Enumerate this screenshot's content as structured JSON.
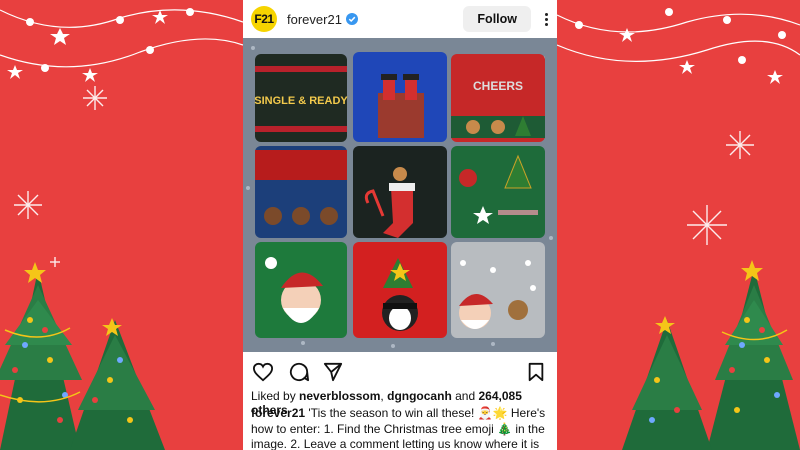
{
  "post": {
    "username": "forever21",
    "logo_text": "F21",
    "follow_label": "Follow",
    "likes": {
      "prefix": "Liked by",
      "user1": "neverblossom",
      "sep": ",",
      "user2": "dgngocanh",
      "and": "and",
      "others": "264,085 others"
    },
    "caption": {
      "author": "forever21",
      "text": "'Tis the season to win all these! 🎅🌟 Here's how to enter: 1. Find the Christmas tree emoji 🎄 in the image. 2. Leave a comment letting us know where it is"
    }
  },
  "sweaters": [
    {
      "text": "SINGLE & READY"
    },
    {
      "text": ""
    },
    {
      "text": "CHEERS"
    }
  ],
  "colors": {
    "background": "#e8403f",
    "verified": "#3897f0",
    "follow_bg": "#efefef"
  }
}
